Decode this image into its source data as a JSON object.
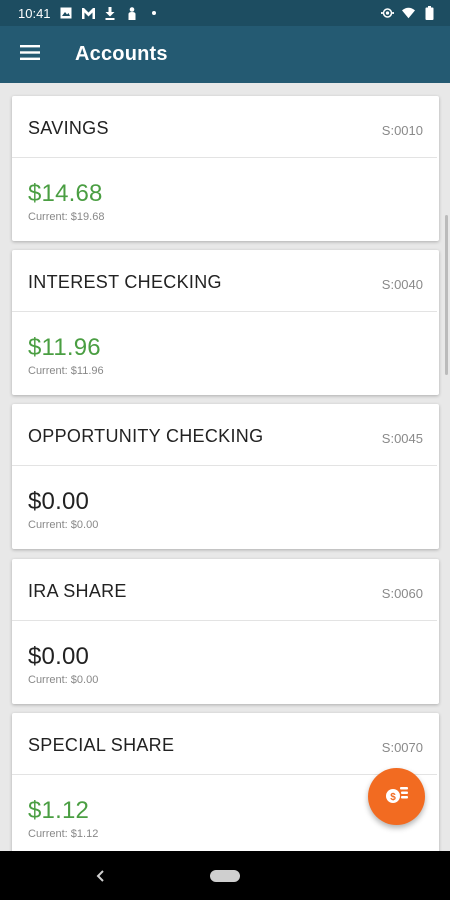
{
  "status_bar": {
    "time": "10:41"
  },
  "app_bar": {
    "title": "Accounts",
    "menu_icon": "hamburger-menu-icon"
  },
  "accounts": [
    {
      "name": "SAVINGS",
      "number": "S:0010",
      "balance": "$14.68",
      "current": "Current: $19.68"
    },
    {
      "name": "INTEREST CHECKING",
      "number": "S:0040",
      "balance": "$11.96",
      "current": "Current: $11.96"
    },
    {
      "name": "OPPORTUNITY CHECKING",
      "number": "S:0045",
      "balance": "$0.00",
      "current": "Current: $0.00"
    },
    {
      "name": "IRA SHARE",
      "number": "S:0060",
      "balance": "$0.00",
      "current": "Current: $0.00"
    },
    {
      "name": "SPECIAL SHARE",
      "number": "S:0070",
      "balance": "$1.12",
      "current": "Current: $1.12"
    }
  ],
  "colors": {
    "positive": "#4a9e42",
    "appbar": "#245a72",
    "fab": "#f26b21"
  },
  "fab": {
    "icon": "transfer-coins-icon"
  }
}
